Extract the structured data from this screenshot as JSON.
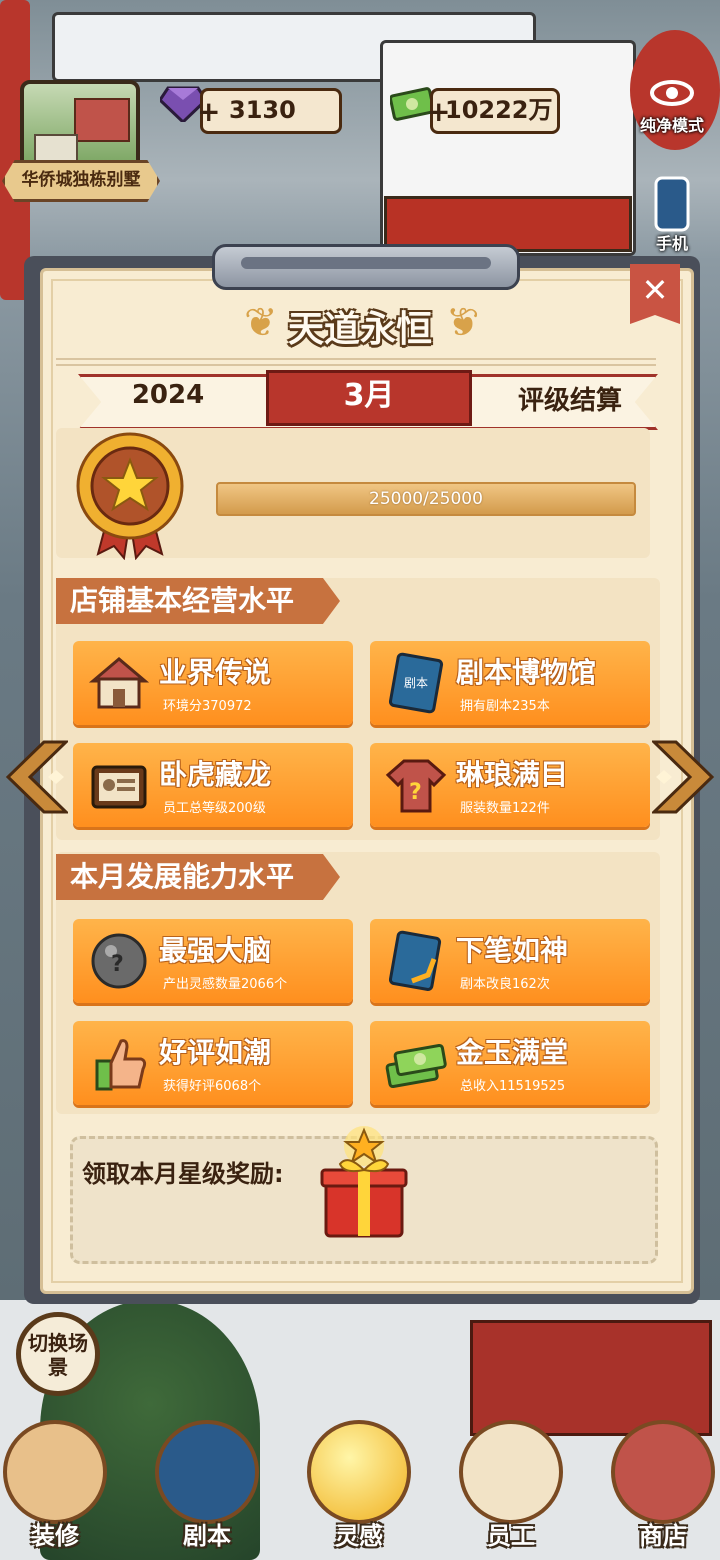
{
  "hud": {
    "location_name": "华侨城独栋别墅",
    "gems": "3130",
    "cash": "10222万",
    "plus": "+",
    "pure_mode_label": "纯净模式",
    "phone_label": "手机"
  },
  "dialog": {
    "title": "天道永恒",
    "close": "✕",
    "year": "2024",
    "month": "3月",
    "settlement": "评级结算",
    "progress_text": "25000/25000",
    "progress": 1.0
  },
  "section1": {
    "title": "店铺基本经营水平",
    "cards": [
      {
        "name": "业界传说",
        "sub": "环境分370972",
        "icon": "shop-icon"
      },
      {
        "name": "剧本博物馆",
        "sub": "拥有剧本235本",
        "icon": "script-book-icon"
      },
      {
        "name": "卧虎藏龙",
        "sub": "员工总等级200级",
        "icon": "id-badge-icon"
      },
      {
        "name": "琳琅满目",
        "sub": "服装数量122件",
        "icon": "shirt-icon"
      }
    ]
  },
  "section2": {
    "title": "本月发展能力水平",
    "cards": [
      {
        "name": "最强大脑",
        "sub": "产出灵感数量2066个",
        "icon": "inspiration-orb-icon"
      },
      {
        "name": "下笔如神",
        "sub": "剧本改良162次",
        "icon": "script-upgrade-icon"
      },
      {
        "name": "好评如潮",
        "sub": "获得好评6068个",
        "icon": "thumbs-up-icon"
      },
      {
        "name": "金玉满堂",
        "sub": "总收入11519525",
        "icon": "money-stack-icon"
      }
    ]
  },
  "book_label": "剧本",
  "reward": {
    "label": "领取本月星级奖励:"
  },
  "bottom": {
    "switch_scene": "切换场景",
    "items": [
      "装修",
      "剧本",
      "灵感",
      "员工",
      "商店"
    ]
  },
  "colors": {
    "card": "#ff9a2a",
    "ribbon_red": "#b8362c",
    "paper": "#f8ecd2",
    "tab": "#c7723f"
  }
}
